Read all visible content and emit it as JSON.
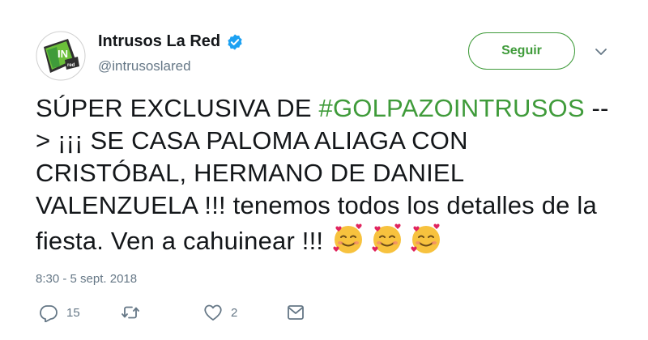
{
  "account": {
    "display_name": "Intrusos La Red",
    "handle": "@intrusoslared",
    "avatar_icon": "intrusos-logo-icon",
    "verified_icon": "verified-badge-icon"
  },
  "follow_button": {
    "label": "Seguir"
  },
  "menu": {
    "icon": "chevron-down-icon"
  },
  "tweet": {
    "text_before_hashtag": "SÚPER EXCLUSIVA DE ",
    "hashtag": "#GOLPAZOINTRUSOS",
    "text_after_hashtag": " --> ¡¡¡ SE CASA PALOMA ALIAGA CON CRISTÓBAL, HERMANO DE DANIEL VALENZUELA !!! tenemos todos los detalles de la fiesta. Ven a cahuinear !!!",
    "emojis": [
      "smiling-face-with-hearts-icon",
      "smiling-face-with-hearts-icon",
      "smiling-face-with-hearts-icon"
    ],
    "timestamp": "8:30 - 5 sept. 2018"
  },
  "actions": {
    "reply_count": "15",
    "retweet_count": "",
    "like_count": "2",
    "reply_icon": "reply-icon",
    "retweet_icon": "retweet-icon",
    "like_icon": "heart-icon",
    "dm_icon": "envelope-icon"
  },
  "colors": {
    "accent": "#3f9b3a",
    "verified": "#1da1f2",
    "muted": "#657786",
    "text": "#14171a"
  }
}
